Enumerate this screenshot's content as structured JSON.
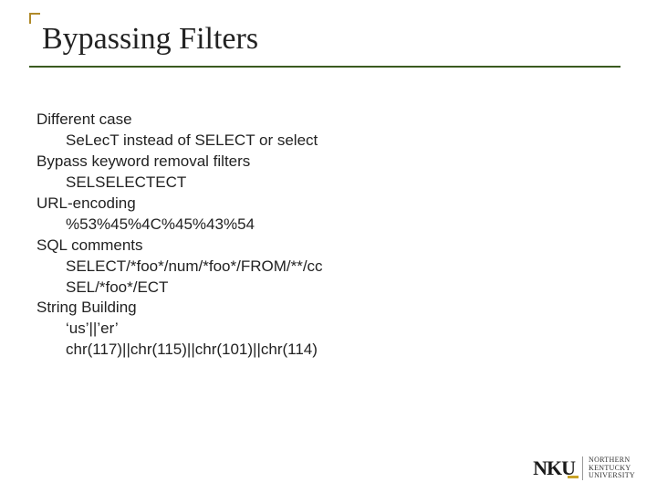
{
  "title": "Bypassing Filters",
  "content": [
    {
      "level": 1,
      "text": "Different case"
    },
    {
      "level": 2,
      "text": "SeLecT instead of SELECT or select"
    },
    {
      "level": 1,
      "text": "Bypass keyword removal filters"
    },
    {
      "level": 2,
      "text": "SELSELECTECT"
    },
    {
      "level": 1,
      "text": "URL-encoding"
    },
    {
      "level": 2,
      "text": "%53%45%4C%45%43%54"
    },
    {
      "level": 1,
      "text": "SQL comments"
    },
    {
      "level": 2,
      "text": "SELECT/*foo*/num/*foo*/FROM/**/cc"
    },
    {
      "level": 2,
      "text": "SEL/*foo*/ECT"
    },
    {
      "level": 1,
      "text": "String Building"
    },
    {
      "level": 2,
      "text": "‘us’||’er’"
    },
    {
      "level": 2,
      "text": "chr(117)||chr(115)||chr(101)||chr(114)"
    }
  ],
  "logo": {
    "mark": "NKU",
    "line1": "NORTHERN",
    "line2": "KENTUCKY",
    "line3": "UNIVERSITY"
  }
}
